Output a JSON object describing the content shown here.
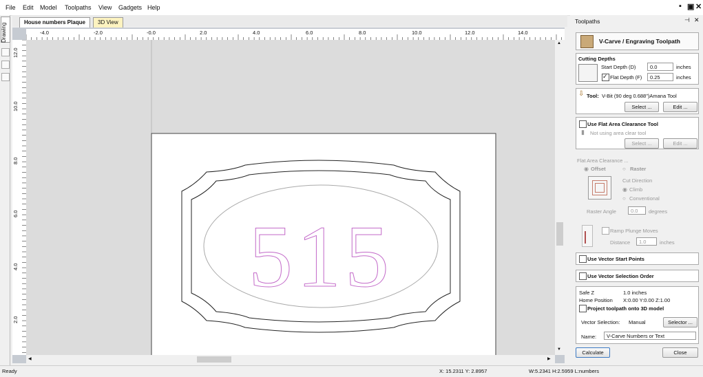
{
  "menubar": {
    "items": [
      "File",
      "Edit",
      "Model",
      "Toolpaths",
      "View",
      "Gadgets",
      "Help"
    ],
    "restore_label": "▪",
    "maximize_label": "▣",
    "close_label": "✕"
  },
  "left_tab": {
    "label": "Drawing"
  },
  "doc_tabs": [
    {
      "label": "House numbers Plaque",
      "active": true
    },
    {
      "label": "3D View",
      "active": false
    }
  ],
  "ruler": {
    "top_ticks": [
      "-4.0",
      "-2.0",
      "-0.0",
      "2.0",
      "4.0",
      "6.0",
      "8.0",
      "10.0",
      "12.0",
      "14.0"
    ],
    "left_ticks": [
      "12.0",
      "10.0",
      "8.0",
      "6.0",
      "4.0",
      "2.0"
    ]
  },
  "drawing": {
    "text": "515",
    "text_color": "#c36ac9",
    "ellipse_color": "#a9a9a9",
    "outline_color": "#222222"
  },
  "status": {
    "ready": "Ready",
    "coords": "X: 15.2311 Y:  2.8957",
    "size": "W:5.2341  H:2.5959  L:numbers"
  },
  "panel": {
    "title": "Toolpaths",
    "toolpath_name": "V-Carve / Engraving Toolpath",
    "cutting_depths": {
      "heading": "Cutting Depths",
      "start_label": "Start Depth (D)",
      "start_value": "0.0",
      "start_unit": "inches",
      "flat_label": "Flat Depth (F)",
      "flat_value": "0.25",
      "flat_unit": "inches"
    },
    "tool": {
      "label": "Tool:",
      "name": "V-Bit (90 deg 0.688\")Amana Tool",
      "select": "Select ...",
      "edit": "Edit ..."
    },
    "flat_clear": {
      "heading": "Use Flat Area Clearance Tool",
      "note": "Not using area clear tool",
      "select": "Select ...",
      "edit": "Edit ..."
    },
    "flat_area": {
      "heading": "Flat Area Clearance ...",
      "offset": "Offset",
      "raster": "Raster",
      "cut_direction": "Cut Direction",
      "climb": "Climb",
      "conventional": "Conventional",
      "raster_angle_label": "Raster Angle",
      "raster_angle_value": "0.0",
      "raster_angle_unit": "degrees"
    },
    "ramp": {
      "label": "Ramp Plunge Moves",
      "distance_label": "Distance",
      "distance_value": "1.0",
      "distance_unit": "inches"
    },
    "vector_start": "Use Vector Start Points",
    "vector_order": "Use Vector Selection Order",
    "safe_z": {
      "label": "Safe Z",
      "value": "1.0 inches"
    },
    "home": {
      "label": "Home Position",
      "value": "X:0.00 Y:0.00 Z:1.00"
    },
    "project": "Project toolpath onto 3D model",
    "vector_selection": {
      "label": "Vector Selection:",
      "value": "Manual",
      "button": "Selector ..."
    },
    "name": {
      "label": "Name:",
      "value": "V-Carve Numbers or Text"
    },
    "calculate": "Calculate",
    "close": "Close"
  }
}
